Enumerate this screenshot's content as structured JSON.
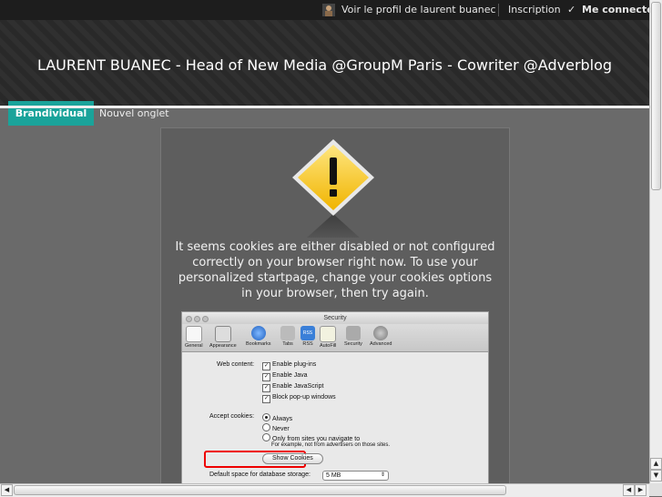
{
  "topbar": {
    "profile_link": "Voir le profil de laurent buanec",
    "signup_link": "Inscription",
    "login_link": "Me connecter"
  },
  "header": {
    "title": "LAURENT BUANEC - Head of New Media @GroupM Paris - Cowriter @Adverblog",
    "tabs": [
      {
        "label": "Brandividual",
        "active": true
      },
      {
        "label": "Nouvel onglet",
        "active": false
      }
    ]
  },
  "notice": {
    "message": "It seems cookies are either disabled or not configured correctly on your browser right now. To use your personalized startpage, change your cookies options in your browser, then try again.",
    "icon": "warning-icon"
  },
  "prefs_screenshot": {
    "window_title": "Security",
    "toolbar": [
      "General",
      "Appearance",
      "Bookmarks",
      "Tabs",
      "RSS",
      "AutoFill",
      "Security",
      "Advanced"
    ],
    "web_content_label": "Web content:",
    "web_content_options": [
      "Enable plug-ins",
      "Enable Java",
      "Enable JavaScript",
      "Block pop-up windows"
    ],
    "accept_cookies_label": "Accept cookies:",
    "cookie_options": [
      "Always",
      "Never",
      "Only from sites you navigate to"
    ],
    "cookie_note": "For example, not from advertisers on those sites.",
    "show_cookies_button": "Show Cookies",
    "db_space_label": "Default space for database storage:",
    "db_space_value": "5 MB"
  },
  "colors": {
    "accent": "#1aa39a",
    "topbar": "#1d1d1d",
    "page_bg": "#6a6a6a",
    "cookie_highlight": "#e00000"
  }
}
